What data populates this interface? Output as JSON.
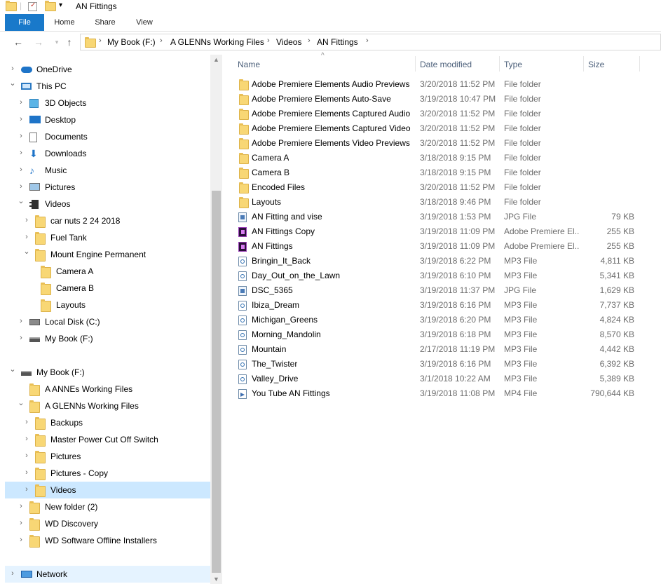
{
  "window": {
    "title": "AN Fittings"
  },
  "ribbon": {
    "tabs": [
      "File",
      "Home",
      "Share",
      "View"
    ]
  },
  "address": {
    "crumbs": [
      "My Book (F:)",
      "A GLENNs Working Files",
      "Videos",
      "AN Fittings"
    ]
  },
  "nav_tree": [
    {
      "label": "OneDrive",
      "indent": 0,
      "chev": ">",
      "icon": "onedrive-icon"
    },
    {
      "label": "This PC",
      "indent": 0,
      "chev": "v",
      "icon": "computer-icon"
    },
    {
      "label": "3D Objects",
      "indent": 1,
      "chev": ">",
      "icon": "3d-objects-icon"
    },
    {
      "label": "Desktop",
      "indent": 1,
      "chev": ">",
      "icon": "desktop-icon"
    },
    {
      "label": "Documents",
      "indent": 1,
      "chev": ">",
      "icon": "documents-icon"
    },
    {
      "label": "Downloads",
      "indent": 1,
      "chev": ">",
      "icon": "downloads-icon"
    },
    {
      "label": "Music",
      "indent": 1,
      "chev": ">",
      "icon": "music-icon"
    },
    {
      "label": "Pictures",
      "indent": 1,
      "chev": ">",
      "icon": "pictures-icon"
    },
    {
      "label": "Videos",
      "indent": 1,
      "chev": "v",
      "icon": "videos-icon"
    },
    {
      "label": "car nuts 2  24  2018",
      "indent": 2,
      "chev": ">",
      "icon": "folder-icon"
    },
    {
      "label": "Fuel Tank",
      "indent": 2,
      "chev": ">",
      "icon": "folder-icon"
    },
    {
      "label": "Mount Engine Permanent",
      "indent": 2,
      "chev": "v",
      "icon": "folder-icon"
    },
    {
      "label": "Camera A",
      "indent": 3,
      "chev": "",
      "icon": "folder-icon"
    },
    {
      "label": "Camera B",
      "indent": 3,
      "chev": "",
      "icon": "folder-icon"
    },
    {
      "label": "Layouts",
      "indent": 3,
      "chev": "",
      "icon": "folder-icon"
    },
    {
      "label": "Local Disk (C:)",
      "indent": 1,
      "chev": ">",
      "icon": "local-disk-icon"
    },
    {
      "label": "My Book (F:)",
      "indent": 1,
      "chev": ">",
      "icon": "drive-icon"
    },
    {
      "label": "",
      "indent": 0,
      "chev": "",
      "icon": ""
    },
    {
      "label": "My Book (F:)",
      "indent": 0,
      "chev": "v",
      "icon": "drive-icon"
    },
    {
      "label": "A ANNEs Working Files",
      "indent": 1,
      "chev": "",
      "icon": "folder-icon"
    },
    {
      "label": "A GLENNs Working Files",
      "indent": 1,
      "chev": "v",
      "icon": "folder-icon"
    },
    {
      "label": "Backups",
      "indent": 2,
      "chev": ">",
      "icon": "folder-icon"
    },
    {
      "label": "Master Power Cut Off Switch",
      "indent": 2,
      "chev": ">",
      "icon": "folder-icon"
    },
    {
      "label": "Pictures",
      "indent": 2,
      "chev": ">",
      "icon": "folder-icon"
    },
    {
      "label": "Pictures - Copy",
      "indent": 2,
      "chev": ">",
      "icon": "folder-icon"
    },
    {
      "label": "Videos",
      "indent": 2,
      "chev": ">",
      "icon": "folder-icon",
      "selected": true
    },
    {
      "label": "New folder (2)",
      "indent": 1,
      "chev": ">",
      "icon": "folder-icon"
    },
    {
      "label": "WD Discovery",
      "indent": 1,
      "chev": ">",
      "icon": "folder-icon"
    },
    {
      "label": "WD Software Offline Installers",
      "indent": 1,
      "chev": ">",
      "icon": "folder-icon"
    },
    {
      "label": "",
      "indent": 0,
      "chev": "",
      "icon": ""
    },
    {
      "label": "Network",
      "indent": 0,
      "chev": ">",
      "icon": "network-icon",
      "hover": true
    }
  ],
  "columns": {
    "name": "Name",
    "date": "Date modified",
    "type": "Type",
    "size": "Size"
  },
  "files": [
    {
      "name": "Adobe Premiere Elements Audio Previews",
      "date": "3/20/2018 11:52 PM",
      "type": "File folder",
      "size": "",
      "kind": "folder"
    },
    {
      "name": "Adobe Premiere Elements Auto-Save",
      "date": "3/19/2018 10:47 PM",
      "type": "File folder",
      "size": "",
      "kind": "folder"
    },
    {
      "name": "Adobe Premiere Elements Captured Audio",
      "date": "3/20/2018 11:52 PM",
      "type": "File folder",
      "size": "",
      "kind": "folder"
    },
    {
      "name": "Adobe Premiere Elements Captured Video",
      "date": "3/20/2018 11:52 PM",
      "type": "File folder",
      "size": "",
      "kind": "folder"
    },
    {
      "name": "Adobe Premiere Elements Video Previews",
      "date": "3/20/2018 11:52 PM",
      "type": "File folder",
      "size": "",
      "kind": "folder"
    },
    {
      "name": "Camera A",
      "date": "3/18/2018 9:15 PM",
      "type": "File folder",
      "size": "",
      "kind": "folder"
    },
    {
      "name": "Camera B",
      "date": "3/18/2018 9:15 PM",
      "type": "File folder",
      "size": "",
      "kind": "folder"
    },
    {
      "name": "Encoded Files",
      "date": "3/20/2018 11:52 PM",
      "type": "File folder",
      "size": "",
      "kind": "folder"
    },
    {
      "name": "Layouts",
      "date": "3/18/2018 9:46 PM",
      "type": "File folder",
      "size": "",
      "kind": "folder"
    },
    {
      "name": "AN Fitting and vise",
      "date": "3/19/2018 1:53 PM",
      "type": "JPG File",
      "size": "79 KB",
      "kind": "jpg"
    },
    {
      "name": "AN Fittings Copy",
      "date": "3/19/2018 11:09 PM",
      "type": "Adobe Premiere El...",
      "size": "255 KB",
      "kind": "prem"
    },
    {
      "name": "AN Fittings",
      "date": "3/19/2018 11:09 PM",
      "type": "Adobe Premiere El...",
      "size": "255 KB",
      "kind": "prem"
    },
    {
      "name": "Bringin_It_Back",
      "date": "3/19/2018 6:22 PM",
      "type": "MP3 File",
      "size": "4,811 KB",
      "kind": "mp3"
    },
    {
      "name": "Day_Out_on_the_Lawn",
      "date": "3/19/2018 6:10 PM",
      "type": "MP3 File",
      "size": "5,341 KB",
      "kind": "mp3"
    },
    {
      "name": "DSC_5365",
      "date": "3/19/2018 11:37 PM",
      "type": "JPG File",
      "size": "1,629 KB",
      "kind": "jpg"
    },
    {
      "name": "Ibiza_Dream",
      "date": "3/19/2018 6:16 PM",
      "type": "MP3 File",
      "size": "7,737 KB",
      "kind": "mp3"
    },
    {
      "name": "Michigan_Greens",
      "date": "3/19/2018 6:20 PM",
      "type": "MP3 File",
      "size": "4,824 KB",
      "kind": "mp3"
    },
    {
      "name": "Morning_Mandolin",
      "date": "3/19/2018 6:18 PM",
      "type": "MP3 File",
      "size": "8,570 KB",
      "kind": "mp3"
    },
    {
      "name": "Mountain",
      "date": "2/17/2018 11:19 PM",
      "type": "MP3 File",
      "size": "4,442 KB",
      "kind": "mp3"
    },
    {
      "name": "The_Twister",
      "date": "3/19/2018 6:16 PM",
      "type": "MP3 File",
      "size": "6,392 KB",
      "kind": "mp3"
    },
    {
      "name": "Valley_Drive",
      "date": "3/1/2018 10:22 AM",
      "type": "MP3 File",
      "size": "5,389 KB",
      "kind": "mp3"
    },
    {
      "name": "You Tube AN Fittings",
      "date": "3/19/2018 11:08 PM",
      "type": "MP4 File",
      "size": "790,644 KB",
      "kind": "mp4"
    }
  ],
  "colors": {
    "accent": "#1979ca",
    "selection": "#cce8ff",
    "folder": "#f8d775"
  }
}
